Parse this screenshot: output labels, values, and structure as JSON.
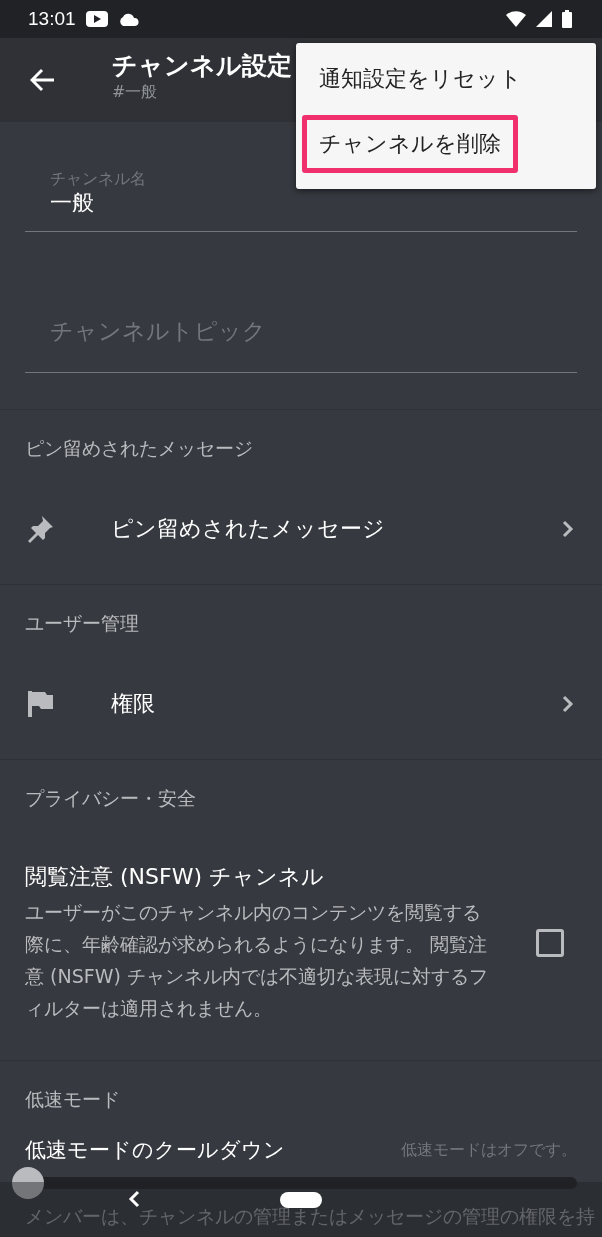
{
  "status_bar": {
    "time": "13:01"
  },
  "header": {
    "title": "チャンネル設定",
    "subtitle": "#一般"
  },
  "menu": {
    "items": [
      {
        "label": "通知設定をリセット",
        "highlighted": false
      },
      {
        "label": "チャンネルを削除",
        "highlighted": true
      }
    ]
  },
  "channel_name": {
    "label": "チャンネル名",
    "value": "一般"
  },
  "channel_topic": {
    "placeholder": "チャンネルトピック"
  },
  "sections": [
    {
      "kind": "link",
      "heading": "ピン留めされたメッセージ",
      "label": "ピン留めされたメッセージ"
    },
    {
      "kind": "link",
      "heading": "ユーザー管理",
      "label": "権限"
    },
    {
      "kind": "checkbox",
      "heading": "プライバシー・安全",
      "label": "閲覧注意 (NSFW) チャンネル",
      "description": "ユーザーがこのチャンネル内のコンテンツを閲覧する際に、年齢確認が求められるようになります。 閲覧注意 (NSFW) チャンネル内では不適切な表現に対するフィルターは適用されません。",
      "checked": false
    },
    {
      "kind": "slider",
      "heading": "低速モード",
      "label": "低速モードのクールダウン",
      "reading": "低速モードはオフです。",
      "level": 0,
      "description": "メンバーは、チャンネルの管理またはメッセージの管理の権限を持"
    }
  ]
}
